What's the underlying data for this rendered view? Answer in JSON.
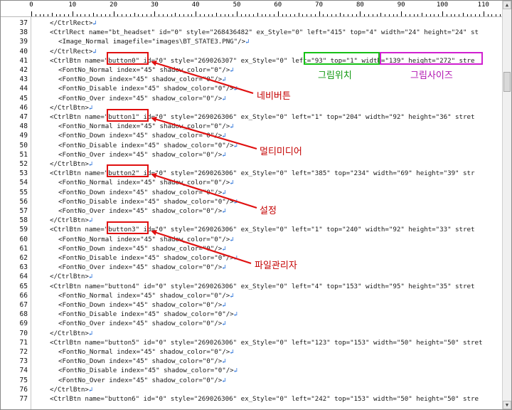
{
  "ruler": {
    "labels": [
      "0",
      "10",
      "20",
      "30",
      "40",
      "50",
      "60",
      "70",
      "80",
      "90",
      "100",
      "110"
    ]
  },
  "lines": [
    {
      "n": "37",
      "indent": 1,
      "text": "</CtrlRect>"
    },
    {
      "n": "38",
      "indent": 1,
      "text": "<CtrlRect name=\"bt_headset\" id=\"0\" style=\"268436482\" ex_Style=\"0\" left=\"415\" top=\"4\" width=\"24\" height=\"24\" st"
    },
    {
      "n": "39",
      "indent": 2,
      "text": "<Image_Normal imagefile=\"images\\BT_STATE3.PNG\"/>"
    },
    {
      "n": "40",
      "indent": 1,
      "text": "</CtrlRect>"
    },
    {
      "n": "41",
      "indent": 1,
      "text": "<CtrlBtn name=\"button0\" id=\"0\" style=\"269026307\" ex_Style=\"0\" left=\"93\" top=\"1\" width=\"139\" height=\"272\" stre"
    },
    {
      "n": "42",
      "indent": 2,
      "text": "<FontNo_Normal index=\"45\" shadow_color=\"0\"/>"
    },
    {
      "n": "43",
      "indent": 2,
      "text": "<FontNo_Down index=\"45\" shadow_color=\"0\"/>"
    },
    {
      "n": "44",
      "indent": 2,
      "text": "<FontNo_Disable index=\"45\" shadow_color=\"0\"/>"
    },
    {
      "n": "45",
      "indent": 2,
      "text": "<FontNo_Over index=\"45\" shadow_color=\"0\"/>"
    },
    {
      "n": "46",
      "indent": 1,
      "text": "</CtrlBtn>"
    },
    {
      "n": "47",
      "indent": 1,
      "text": "<CtrlBtn name=\"button1\" id=\"0\" style=\"269026306\" ex_Style=\"0\" left=\"1\" top=\"204\" width=\"92\" height=\"36\" stret"
    },
    {
      "n": "48",
      "indent": 2,
      "text": "<FontNo_Normal index=\"45\" shadow_color=\"0\"/>"
    },
    {
      "n": "49",
      "indent": 2,
      "text": "<FontNo_Down index=\"45\" shadow_color=\"0\"/>"
    },
    {
      "n": "50",
      "indent": 2,
      "text": "<FontNo_Disable index=\"45\" shadow_color=\"0\"/>"
    },
    {
      "n": "51",
      "indent": 2,
      "text": "<FontNo_Over index=\"45\" shadow_color=\"0\"/>"
    },
    {
      "n": "52",
      "indent": 1,
      "text": "</CtrlBtn>"
    },
    {
      "n": "53",
      "indent": 1,
      "text": "<CtrlBtn name=\"button2\" id=\"0\" style=\"269026306\" ex_Style=\"0\" left=\"385\" top=\"234\" width=\"69\" height=\"39\" str"
    },
    {
      "n": "54",
      "indent": 2,
      "text": "<FontNo_Normal index=\"45\" shadow_color=\"0\"/>"
    },
    {
      "n": "55",
      "indent": 2,
      "text": "<FontNo_Down index=\"45\" shadow_color=\"0\"/>"
    },
    {
      "n": "56",
      "indent": 2,
      "text": "<FontNo_Disable index=\"45\" shadow_color=\"0\"/>"
    },
    {
      "n": "57",
      "indent": 2,
      "text": "<FontNo_Over index=\"45\" shadow_color=\"0\"/>"
    },
    {
      "n": "58",
      "indent": 1,
      "text": "</CtrlBtn>"
    },
    {
      "n": "59",
      "indent": 1,
      "text": "<CtrlBtn name=\"button3\" id=\"0\" style=\"269026306\" ex_Style=\"0\" left=\"1\" top=\"240\" width=\"92\" height=\"33\" stret"
    },
    {
      "n": "60",
      "indent": 2,
      "text": "<FontNo_Normal index=\"45\" shadow_color=\"0\"/>"
    },
    {
      "n": "61",
      "indent": 2,
      "text": "<FontNo_Down index=\"45\" shadow_color=\"0\"/>"
    },
    {
      "n": "62",
      "indent": 2,
      "text": "<FontNo_Disable index=\"45\" shadow_color=\"0\"/>"
    },
    {
      "n": "63",
      "indent": 2,
      "text": "<FontNo_Over index=\"45\" shadow_color=\"0\"/>"
    },
    {
      "n": "64",
      "indent": 1,
      "text": "</CtrlBtn>"
    },
    {
      "n": "65",
      "indent": 1,
      "text": "<CtrlBtn name=\"button4\" id=\"0\" style=\"269026306\" ex_Style=\"0\" left=\"4\" top=\"153\" width=\"95\" height=\"35\" stret"
    },
    {
      "n": "66",
      "indent": 2,
      "text": "<FontNo_Normal index=\"45\" shadow_color=\"0\"/>"
    },
    {
      "n": "67",
      "indent": 2,
      "text": "<FontNo_Down index=\"45\" shadow_color=\"0\"/>"
    },
    {
      "n": "68",
      "indent": 2,
      "text": "<FontNo_Disable index=\"45\" shadow_color=\"0\"/>"
    },
    {
      "n": "69",
      "indent": 2,
      "text": "<FontNo_Over index=\"45\" shadow_color=\"0\"/>"
    },
    {
      "n": "70",
      "indent": 1,
      "text": "</CtrlBtn>"
    },
    {
      "n": "71",
      "indent": 1,
      "text": "<CtrlBtn name=\"button5\" id=\"0\" style=\"269026306\" ex_Style=\"0\" left=\"123\" top=\"153\" width=\"50\" height=\"50\" stret"
    },
    {
      "n": "72",
      "indent": 2,
      "text": "<FontNo_Normal index=\"45\" shadow_color=\"0\"/>"
    },
    {
      "n": "73",
      "indent": 2,
      "text": "<FontNo_Down index=\"45\" shadow_color=\"0\"/>"
    },
    {
      "n": "74",
      "indent": 2,
      "text": "<FontNo_Disable index=\"45\" shadow_color=\"0\"/>"
    },
    {
      "n": "75",
      "indent": 2,
      "text": "<FontNo_Over index=\"45\" shadow_color=\"0\"/>"
    },
    {
      "n": "76",
      "indent": 1,
      "text": "</CtrlBtn>"
    },
    {
      "n": "77",
      "indent": 1,
      "text": "<CtrlBtn name=\"button6\" id=\"0\" style=\"269026306\" ex_Style=\"0\" left=\"242\" top=\"153\" width=\"50\" height=\"50\" stre"
    }
  ],
  "return_glyph": "↲",
  "annotations": {
    "button0": "네비버튼",
    "button1": "멀티미디어",
    "button2": "설정",
    "button3": "파일관리자",
    "position": "그림위치",
    "size": "그림사이즈"
  },
  "colors": {
    "red": "#e01010",
    "green": "#16c216",
    "magenta": "#d020d0",
    "return_arrow": "#1e6ad8"
  }
}
